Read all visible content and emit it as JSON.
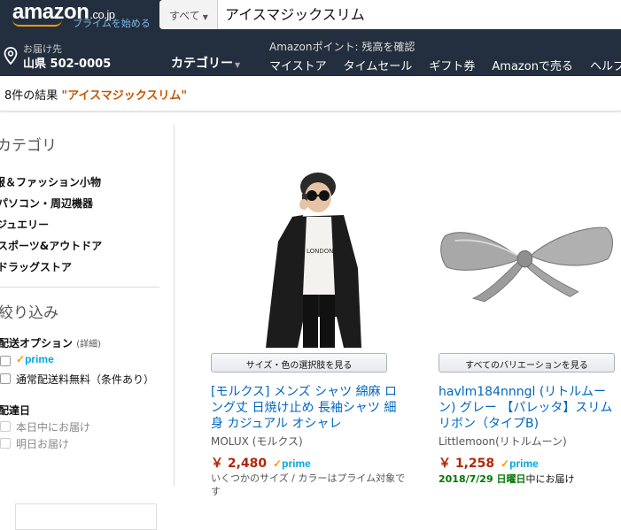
{
  "header": {
    "logo_text": "amazon",
    "logo_tld": ".co.jp",
    "prime_link": "プライムを始める",
    "search_dept": "すべて",
    "search_value": "アイスマジックスリム"
  },
  "nav": {
    "deliver_to": "お届け先",
    "deliver_address": "山県 502-0005",
    "category_label": "カテゴリー",
    "points_text": "Amazonポイント: 残高を確認",
    "links": [
      "マイストア",
      "タイムセール",
      "ギフト券",
      "Amazonで売る",
      "ヘルプ"
    ]
  },
  "results": {
    "count_text": "8件の結果",
    "query": "\"アイスマジックスリム\""
  },
  "sidebar": {
    "category_heading": "カテゴリ",
    "categories": [
      "服＆ファッション小物",
      "パソコン・周辺機器",
      "ジュエリー",
      "スポーツ&アウトドア",
      "ドラッグストア"
    ],
    "refine_heading": "絞り込み",
    "shipping_label": "配送オプション",
    "shipping_detail": "(詳細)",
    "prime_label": "prime",
    "free_shipping": "通常配送料無料（条件あり）",
    "delivery_date_label": "配達日",
    "delivery_today": "本日中にお届け",
    "delivery_tomorrow": "明日お届け"
  },
  "products": [
    {
      "variant_button": "サイズ・色の選択肢を見る",
      "title": "[モルクス] メンズ シャツ 綿麻 ロング丈 日焼け止め 長袖シャツ 細身 カジュアル オシャレ",
      "brand": "MOLUX (モルクス)",
      "price": "￥ 2,480",
      "prime": "prime",
      "note": "いくつかのサイズ / カラーはプライム対象です"
    },
    {
      "variant_button": "すべてのバリエーションを見る",
      "title": "havlm184nnngl (リトルムーン) グレー 【パレッタ】スリムリボン（タイプB)",
      "brand": "Littlemoon(リトルムーン)",
      "price": "￥ 1,258",
      "prime": "prime",
      "delivery_date": "2018/7/29 日曜日",
      "delivery_suffix": "中にお届け"
    }
  ]
}
